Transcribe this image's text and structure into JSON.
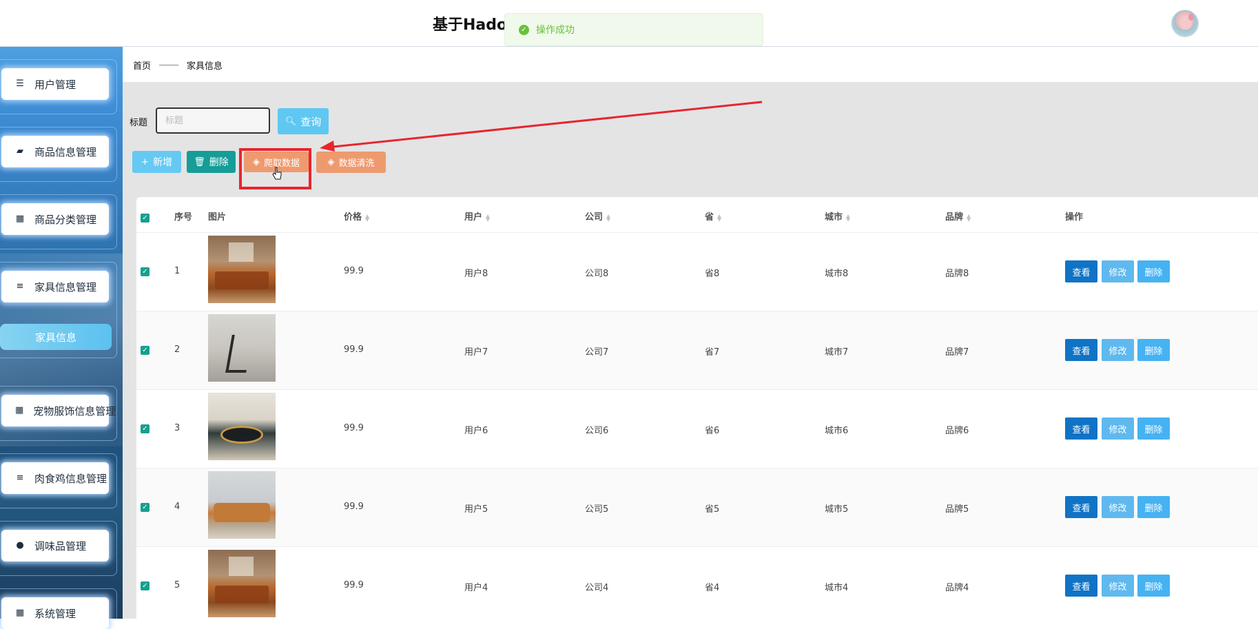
{
  "header": {
    "title": "基于Hado"
  },
  "toast": {
    "message": "操作成功"
  },
  "sidebar": {
    "items": [
      {
        "label": "用户管理",
        "icon": "sliders-icon"
      },
      {
        "label": "商品信息管理",
        "icon": "briefcase-icon"
      },
      {
        "label": "商品分类管理",
        "icon": "grid-icon"
      },
      {
        "label": "家具信息管理",
        "icon": "list-icon"
      },
      {
        "label": "宠物服饰信息管理",
        "icon": "grid-icon"
      },
      {
        "label": "肉食鸡信息管理",
        "icon": "list-icon"
      },
      {
        "label": "调味品管理",
        "icon": "bulb-icon"
      },
      {
        "label": "系统管理",
        "icon": "grid-icon"
      }
    ],
    "active_submenu": "家具信息"
  },
  "breadcrumb": {
    "home": "首页",
    "current": "家具信息"
  },
  "search": {
    "label": "标题",
    "placeholder": "标题",
    "query_button": "查询"
  },
  "toolbar": {
    "add": "新增",
    "delete": "删除",
    "crawl": "爬取数据",
    "clean": "数据清洗"
  },
  "table": {
    "columns": [
      "序号",
      "图片",
      "价格",
      "用户",
      "公司",
      "省",
      "城市",
      "品牌",
      "操作"
    ],
    "rows": [
      {
        "index": "1",
        "price": "99.9",
        "user": "用户8",
        "company": "公司8",
        "province": "省8",
        "city": "城市8",
        "brand": "品牌8"
      },
      {
        "index": "2",
        "price": "99.9",
        "user": "用户7",
        "company": "公司7",
        "province": "省7",
        "city": "城市7",
        "brand": "品牌7"
      },
      {
        "index": "3",
        "price": "99.9",
        "user": "用户6",
        "company": "公司6",
        "province": "省6",
        "city": "城市6",
        "brand": "品牌6"
      },
      {
        "index": "4",
        "price": "99.9",
        "user": "用户5",
        "company": "公司5",
        "province": "省5",
        "city": "城市5",
        "brand": "品牌5"
      },
      {
        "index": "5",
        "price": "99.9",
        "user": "用户4",
        "company": "公司4",
        "province": "省4",
        "city": "城市4",
        "brand": "品牌4"
      }
    ],
    "actions": {
      "view": "查看",
      "edit": "修改",
      "delete": "删除"
    }
  },
  "colors": {
    "toast_success": "#67c23a",
    "crawl_button": "#ee9a6f",
    "highlight": "#e8252d",
    "view_button": "#0f73c6"
  }
}
